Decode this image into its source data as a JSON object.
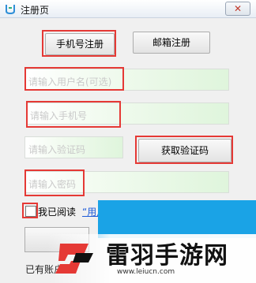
{
  "window": {
    "title": "注册页",
    "close_glyph": "✕"
  },
  "tabs": {
    "phone_register": "手机号注册",
    "email_register": "邮箱注册"
  },
  "form": {
    "username_placeholder": "请输入用户名(可选)",
    "phone_placeholder": "请输入手机号",
    "code_placeholder": "请输入验证码",
    "get_code_label": "获取验证码",
    "password_placeholder": "请输入密码"
  },
  "agreement": {
    "text": "我已阅读",
    "link": "“用户"
  },
  "footer": {
    "has_account": "已有账户"
  },
  "watermark": {
    "title": "雷羽手游网",
    "url": "www.leiucn.com"
  },
  "colors": {
    "accent_red": "#e53935",
    "link": "#1e5bd8",
    "popup": "#1aa3e6",
    "field_tint": "#dff5dc"
  }
}
